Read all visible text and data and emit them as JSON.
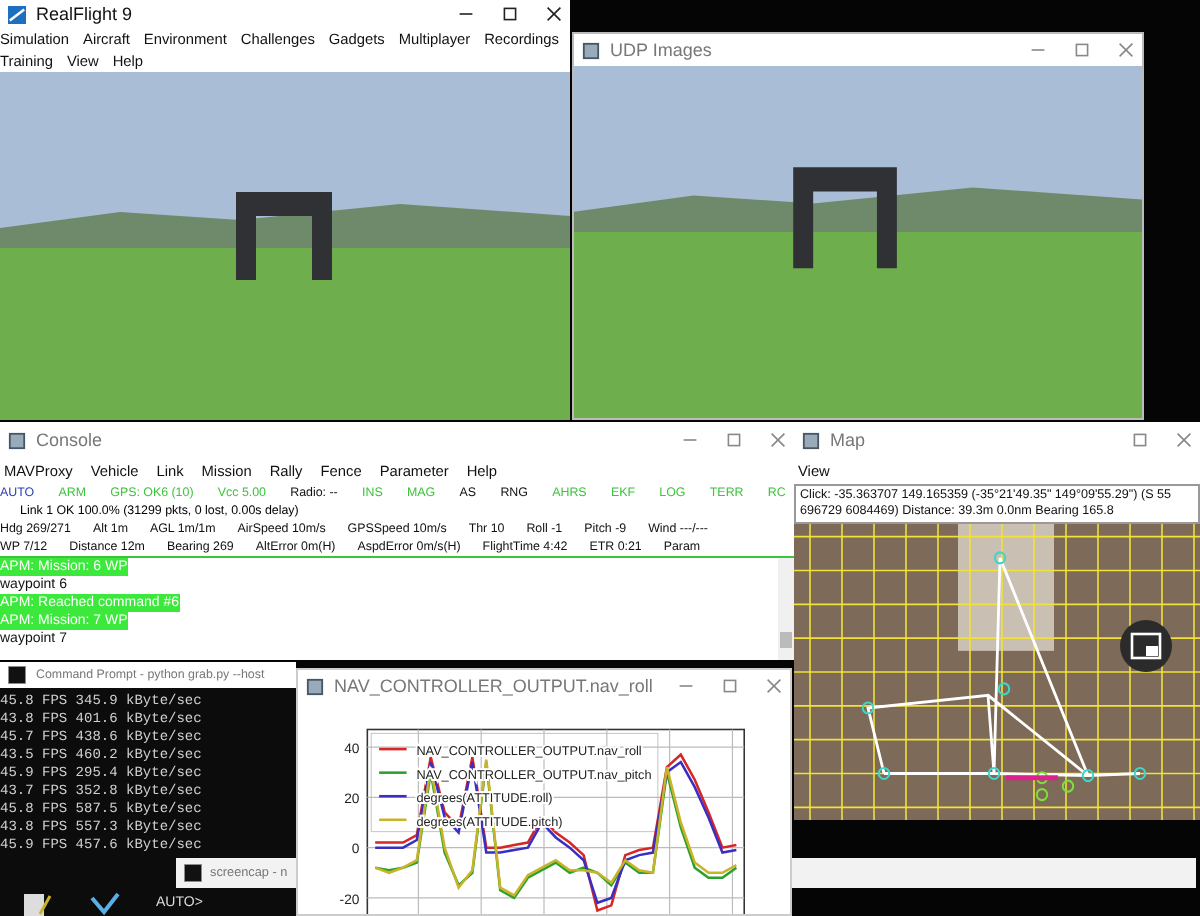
{
  "realflight": {
    "title": "RealFlight 9",
    "menu_rows": [
      [
        "Simulation",
        "Aircraft",
        "Environment",
        "Challenges",
        "Gadgets",
        "Multiplayer",
        "Recordings"
      ],
      [
        "Training",
        "View",
        "Help"
      ]
    ]
  },
  "udp_images": {
    "title": "UDP Images"
  },
  "console": {
    "title": "Console",
    "menu": [
      "MAVProxy",
      "Vehicle",
      "Link",
      "Mission",
      "Rally",
      "Fence",
      "Parameter",
      "Help"
    ],
    "status_items": [
      {
        "label": "AUTO",
        "color": "#2a3fb8"
      },
      {
        "label": "ARM",
        "color": "#3cc43c"
      },
      {
        "label": "GPS: OK6 (10)",
        "color": "#3cc43c"
      },
      {
        "label": "Vcc 5.00",
        "color": "#3cc43c"
      },
      {
        "label": "Radio: --",
        "color": "#111111"
      },
      {
        "label": "INS",
        "color": "#3cc43c"
      },
      {
        "label": "MAG",
        "color": "#3cc43c"
      },
      {
        "label": "AS",
        "color": "#111111"
      },
      {
        "label": "RNG",
        "color": "#111111"
      },
      {
        "label": "AHRS",
        "color": "#3cc43c"
      },
      {
        "label": "EKF",
        "color": "#3cc43c"
      },
      {
        "label": "LOG",
        "color": "#3cc43c"
      },
      {
        "label": "TERR",
        "color": "#3cc43c"
      },
      {
        "label": "RC",
        "color": "#3cc43c"
      }
    ],
    "link_line": "Link 1 OK 100.0% (31299 pkts, 0 lost, 0.00s delay)",
    "telemetry_rows": [
      [
        "Hdg 269/271",
        "Alt 1m",
        "AGL 1m/1m",
        "AirSpeed 10m/s",
        "GPSSpeed 10m/s",
        "Thr 10",
        "Roll -1",
        "Pitch -9",
        "Wind ---/---"
      ],
      [
        "WP 7/12",
        "Distance 12m",
        "Bearing 269",
        "AltError 0m(H)",
        "AspdError 0m/s(H)",
        "FlightTime 4:42",
        "ETR 0:21",
        "Param"
      ]
    ],
    "log": [
      {
        "text": "APM: Mission: 6 WP",
        "highlighted": true
      },
      {
        "text": "waypoint 6",
        "highlighted": false
      },
      {
        "text": "APM: Reached command #6",
        "highlighted": true
      },
      {
        "text": "APM: Mission: 7 WP",
        "highlighted": true
      },
      {
        "text": "waypoint 7",
        "highlighted": false
      }
    ]
  },
  "map": {
    "title": "Map",
    "menu": [
      "View"
    ],
    "click_info": "Click: -35.363707 149.165359 (-35°21'49.35\" 149°09'55.29\") (S 55 696729 6084469)  Distance: 39.3m 0.0nm Bearing 165.8"
  },
  "command_prompt": {
    "title": "Command Prompt - python  grab.py --host",
    "lines": [
      "45.8 FPS 345.9 kByte/sec",
      "43.8 FPS 401.6 kByte/sec",
      "45.7 FPS 438.6 kByte/sec",
      "43.5 FPS 460.2 kByte/sec",
      "45.9 FPS 295.4 kByte/sec",
      "43.7 FPS 352.8 kByte/sec",
      "45.8 FPS 587.5 kByte/sec",
      "43.8 FPS 557.3 kByte/sec",
      "45.9 FPS 457.6 kByte/sec"
    ]
  },
  "screencap": {
    "title": "screencap - n"
  },
  "prompt": "AUTO>",
  "nav_plot": {
    "title": "NAV_CONTROLLER_OUTPUT.nav_roll",
    "chart_data": {
      "type": "line",
      "ylim": [
        -27,
        47
      ],
      "yticks": [
        -20,
        0,
        20,
        40
      ],
      "grid": true,
      "legend": "upper left",
      "series": [
        {
          "name": "NAV_CONTROLLER_OUTPUT.nav_roll",
          "color": "#d62728",
          "values": [
            2,
            2,
            2,
            5,
            36,
            14,
            8,
            36,
            0,
            0,
            1,
            2,
            12,
            6,
            2,
            -3,
            -25,
            -23,
            -3,
            -1,
            0,
            32,
            37,
            27,
            14,
            0,
            1
          ]
        },
        {
          "name": "NAV_CONTROLLER_OUTPUT.nav_pitch",
          "color": "#2ca02c",
          "values": [
            -8,
            -9,
            -8,
            -6,
            30,
            -2,
            -15,
            -10,
            34,
            -17,
            -20,
            -12,
            -9,
            -6,
            -10,
            -8,
            -10,
            -15,
            -6,
            -10,
            -10,
            30,
            8,
            -8,
            -12,
            -12,
            -8
          ]
        },
        {
          "name": "degrees(ATTITUDE.roll)",
          "color": "#3a2fc0",
          "values": [
            0,
            0,
            0,
            3,
            34,
            12,
            6,
            34,
            -2,
            -2,
            -1,
            0,
            10,
            4,
            0,
            -5,
            -22,
            -20,
            -5,
            -3,
            -2,
            30,
            34,
            24,
            12,
            -2,
            -1
          ]
        },
        {
          "name": "degrees(ATTITUDE.pitch)",
          "color": "#c8b42a",
          "values": [
            -8,
            -10,
            -8,
            -5,
            32,
            0,
            -16,
            -9,
            35,
            -16,
            -19,
            -11,
            -8,
            -5,
            -9,
            -9,
            -10,
            -14,
            -5,
            -9,
            -10,
            32,
            10,
            -6,
            -10,
            -10,
            -7
          ]
        }
      ]
    }
  }
}
